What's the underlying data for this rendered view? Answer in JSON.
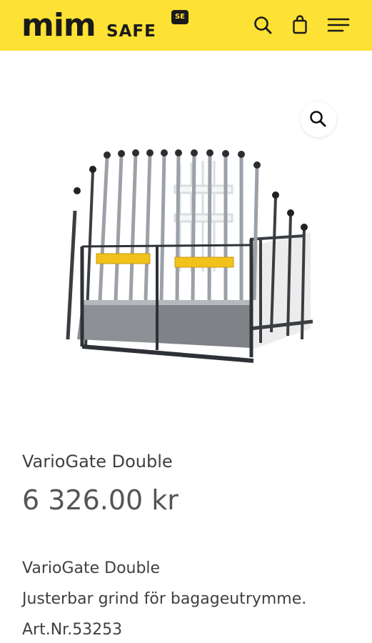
{
  "header": {
    "logo_main": "mim",
    "logo_sub": "SAFE",
    "logo_badge": "SE",
    "background_color": "#fde135",
    "icons": [
      "search-icon",
      "shopping-bag-icon",
      "menu-icon"
    ]
  },
  "gallery": {
    "zoom_icon": "magnifier-icon",
    "image_subject": "product-photo"
  },
  "product": {
    "title": "VarioGate Double",
    "price": "6 326.00 kr",
    "description": [
      "VarioGate Double",
      "Justerbar grind för bagageutrymme.",
      "Art.Nr.53253"
    ]
  }
}
